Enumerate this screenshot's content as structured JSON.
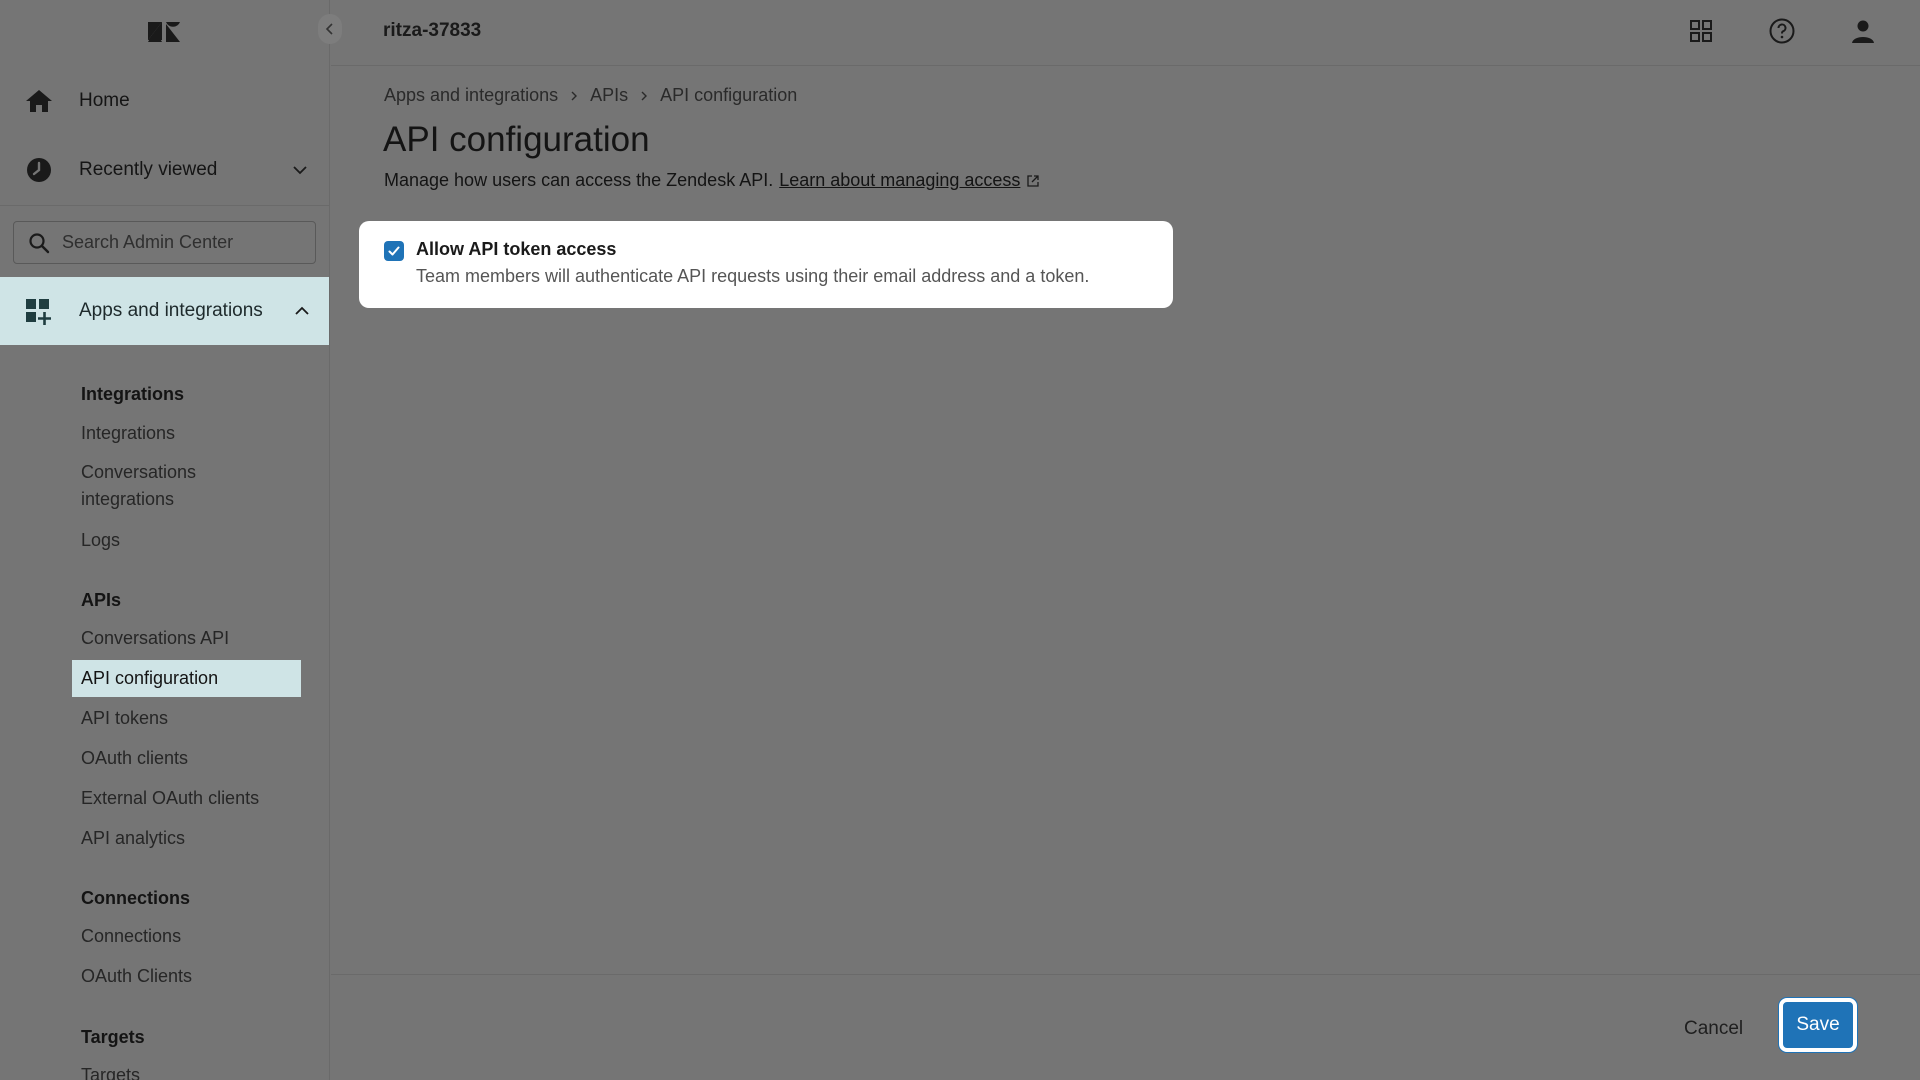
{
  "header": {
    "workspace": "ritza-37833",
    "icons": [
      "zendesk-logo",
      "products-grid-icon",
      "help-icon",
      "user-icon"
    ]
  },
  "sidebar": {
    "home_label": "Home",
    "recent_label": "Recently viewed",
    "search_placeholder": "Search Admin Center",
    "active_section_label": "Apps and integrations",
    "groups": [
      {
        "heading": "Integrations",
        "items": [
          "Integrations",
          "Conversations integrations",
          "Logs"
        ]
      },
      {
        "heading": "APIs",
        "items": [
          "Conversations API",
          "API configuration",
          "API tokens",
          "OAuth clients",
          "External OAuth clients",
          "API analytics"
        ]
      },
      {
        "heading": "Connections",
        "items": [
          "Connections",
          "OAuth Clients"
        ]
      },
      {
        "heading": "Targets",
        "items": [
          "Targets"
        ]
      }
    ],
    "conversations_integrations_line1": "Conversations",
    "conversations_integrations_line2": "integrations",
    "active_item": "API configuration"
  },
  "breadcrumb": [
    "Apps and integrations",
    "APIs",
    "API configuration"
  ],
  "main": {
    "title": "API configuration",
    "description": "Manage how users can access the Zendesk API.",
    "learn_link": "Learn about managing access",
    "setting": {
      "label": "Allow API token access",
      "hint": "Team members will authenticate API requests using their email address and a token.",
      "checked": true
    }
  },
  "footer": {
    "cancel_label": "Cancel",
    "save_label": "Save"
  },
  "colors": {
    "accent": "#1f73b7",
    "active_bg": "#cfe4e6",
    "overlay": "#757575"
  }
}
